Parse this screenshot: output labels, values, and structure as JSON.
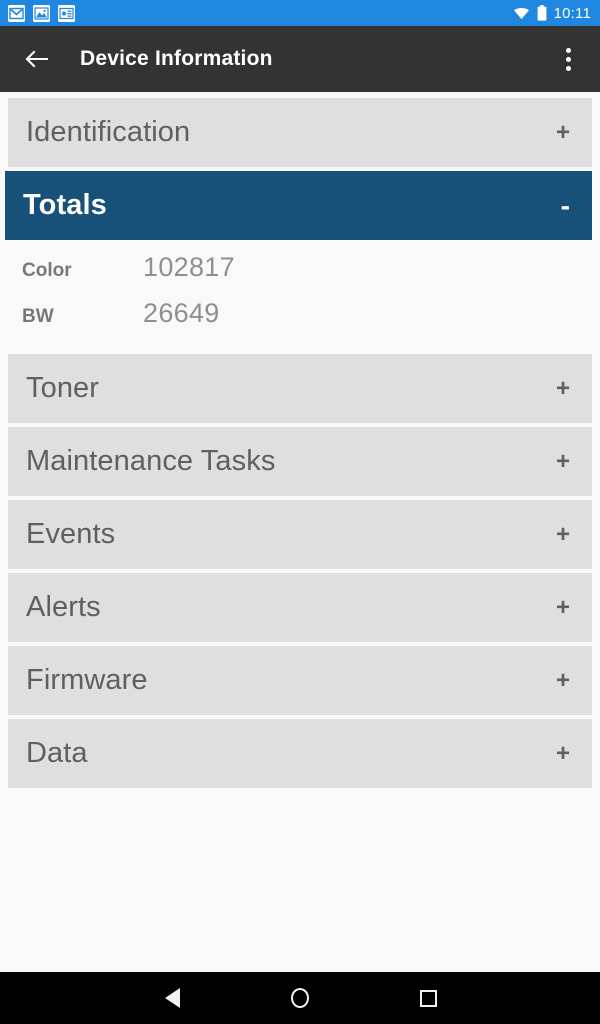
{
  "statusbar": {
    "notification_icons": [
      "gmail-icon",
      "photos-icon",
      "news-card-icon"
    ],
    "wifi_icon": "wifi-icon",
    "battery_icon": "battery-full-icon",
    "clock": "10:11",
    "background": "#2087e0"
  },
  "appbar": {
    "back_icon": "arrow-back-icon",
    "title": "Device Information",
    "overflow_icon": "more-vertical-icon",
    "background": "#333333"
  },
  "accent": {
    "active_section": "#17517a",
    "section_row": "#dfdfdf",
    "page_background": "#f9f9f9"
  },
  "sections": [
    {
      "label": "Identification",
      "sign": "+",
      "expanded": false
    },
    {
      "label": "Totals",
      "sign": "-",
      "expanded": true
    },
    {
      "label": "Toner",
      "sign": "+",
      "expanded": false
    },
    {
      "label": "Maintenance Tasks",
      "sign": "+",
      "expanded": false
    },
    {
      "label": "Events",
      "sign": "+",
      "expanded": false
    },
    {
      "label": "Alerts",
      "sign": "+",
      "expanded": false
    },
    {
      "label": "Firmware",
      "sign": "+",
      "expanded": false
    },
    {
      "label": "Data",
      "sign": "+",
      "expanded": false
    }
  ],
  "totals": {
    "rows": [
      {
        "label": "Color",
        "value": "102817"
      },
      {
        "label": "BW",
        "value": "26649"
      }
    ]
  },
  "navbar": {
    "back": "nav-back-icon",
    "home": "nav-home-icon",
    "recents": "nav-recents-icon"
  }
}
